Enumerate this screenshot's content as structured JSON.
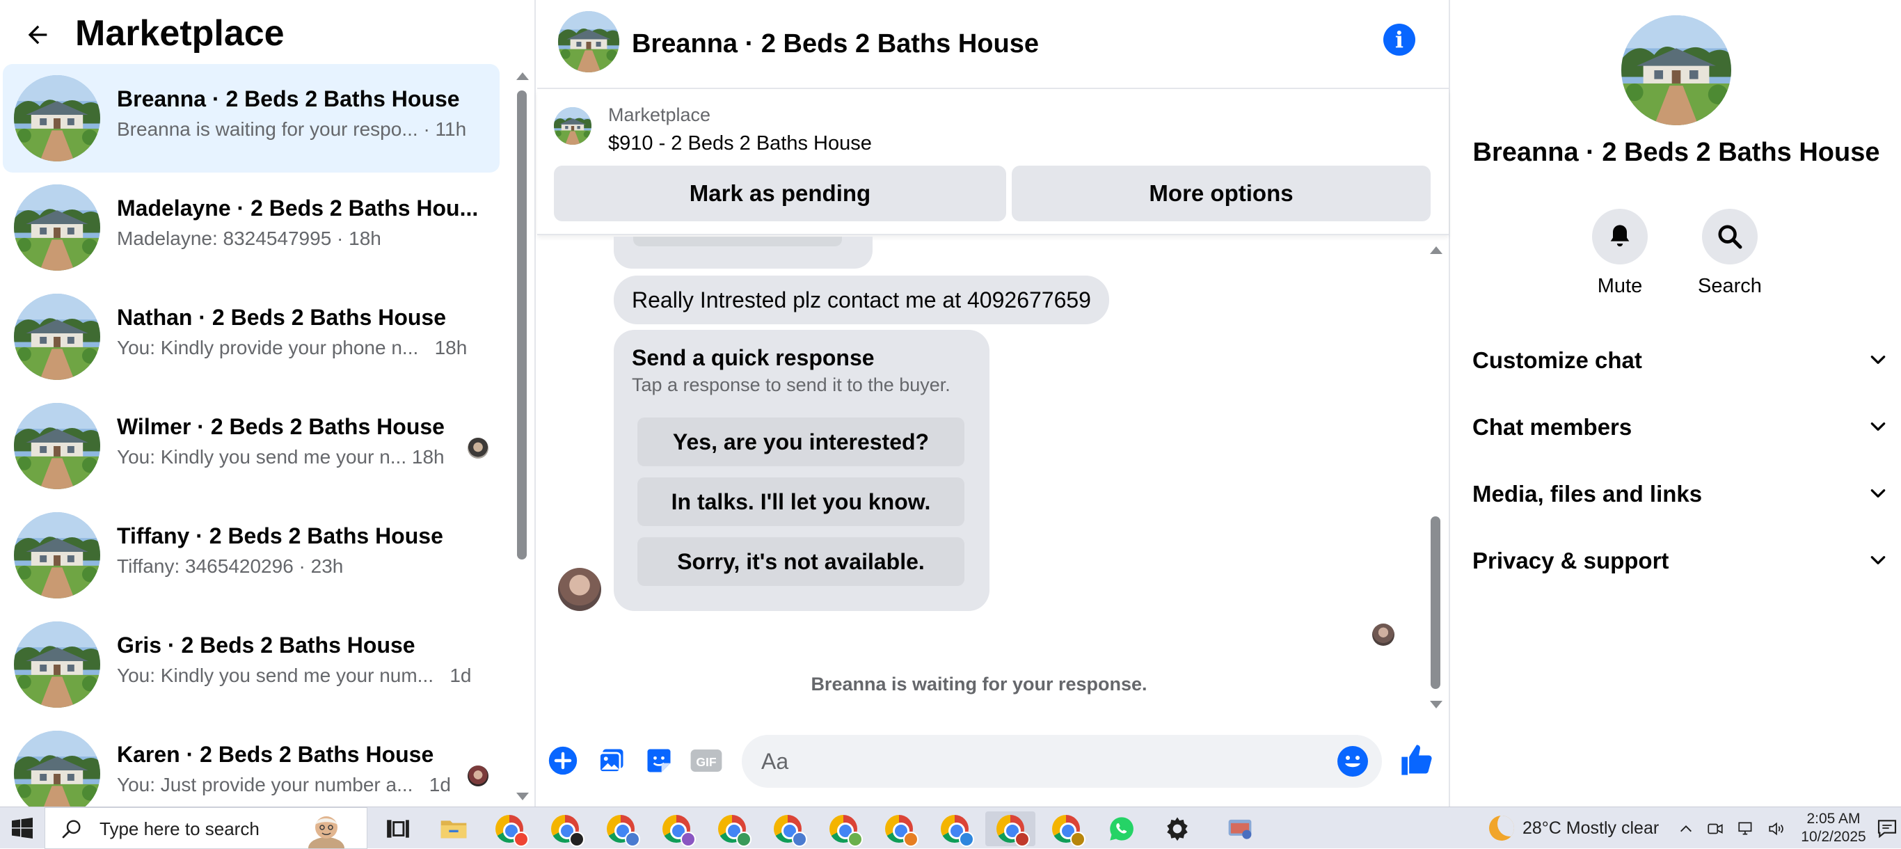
{
  "sidebar": {
    "title": "Marketplace",
    "conversations": [
      {
        "title": "Breanna · 2 Beds 2 Baths House",
        "snippet": "Breanna is waiting for your respo...",
        "time": "· 11h"
      },
      {
        "title": "Madelayne · 2 Beds 2 Baths Hou...",
        "snippet": "Madelayne: 8324547995",
        "time": "· 18h"
      },
      {
        "title": "Nathan · 2 Beds 2 Baths House",
        "snippet": "You: Kindly provide your phone n...",
        "time": "18h"
      },
      {
        "title": "Wilmer · 2 Beds 2 Baths House",
        "snippet": "You: Kindly you send me your n...",
        "time": "18h"
      },
      {
        "title": "Tiffany · 2 Beds 2 Baths House",
        "snippet": "Tiffany: 3465420296",
        "time": "· 23h"
      },
      {
        "title": "Gris · 2 Beds 2 Baths House",
        "snippet": "You: Kindly you send me your num...",
        "time": "1d"
      },
      {
        "title": "Karen · 2 Beds 2 Baths House",
        "snippet": "You: Just provide your number a...",
        "time": "1d"
      }
    ]
  },
  "chat": {
    "header_name": "Breanna · 2 Beds 2 Baths House",
    "listing_source": "Marketplace",
    "listing_price_title": "$910 - 2 Beds 2 Baths House",
    "mark_pending_label": "Mark as pending",
    "more_options_label": "More options",
    "message_text": "Really Intrested plz contact me at 4092677659",
    "quick_response": {
      "title": "Send a quick response",
      "subtitle": "Tap a response to send it to the buyer.",
      "options": [
        "Yes, are you interested?",
        "In talks. I'll let you know.",
        "Sorry, it's not available."
      ]
    },
    "waiting_text": "Breanna is waiting for your response.",
    "composer_placeholder": "Aa",
    "gif_label": "GIF"
  },
  "details": {
    "name": "Breanna · 2 Beds 2 Baths House",
    "mute_label": "Mute",
    "search_label": "Search",
    "sections": [
      "Customize chat",
      "Chat members",
      "Media, files and links",
      "Privacy & support"
    ]
  },
  "taskbar": {
    "search_placeholder": "Type here to search",
    "weather": "28°C  Mostly clear",
    "time": "2:05 AM",
    "date": "10/2/2025"
  },
  "colors": {
    "accent": "#0866ff",
    "active_row": "#e7f3ff",
    "bubble": "#e4e6eb",
    "secondary_text": "#65676b"
  },
  "icons": [
    "back-arrow-icon",
    "info-icon",
    "add-circle-icon",
    "photo-icon",
    "sticker-icon",
    "gif-icon",
    "emoji-icon",
    "thumbs-up-icon",
    "bell-icon",
    "search-icon",
    "chevron-down-icon",
    "windows-start-icon",
    "chrome-icon",
    "whatsapp-icon",
    "settings-icon"
  ]
}
